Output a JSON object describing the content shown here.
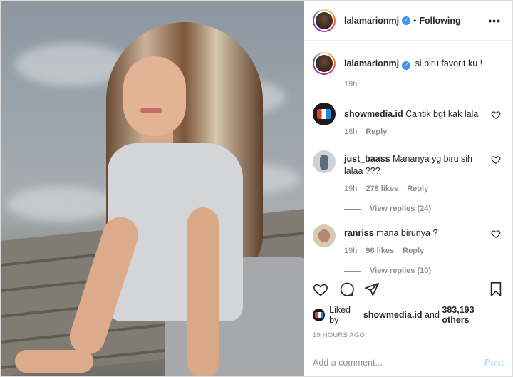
{
  "post": {
    "author": "lalamarionmj",
    "follow_separator": "•",
    "follow_state": "Following",
    "more_icon": "more-horizontal-icon"
  },
  "caption": {
    "username": "lalamarionmj",
    "text": "si biru favorit ku !",
    "time": "19h"
  },
  "comments": [
    {
      "username": "showmedia.id",
      "text": "Cantik bgt kak lala",
      "time": "18h",
      "reply_label": "Reply"
    },
    {
      "username": "just_baass",
      "text": "Mananya yg biru sih lalaa ???",
      "time": "19h",
      "likes": "278 likes",
      "reply_label": "Reply",
      "view_replies": "View replies (24)"
    },
    {
      "username": "ranriss",
      "text": "mana birunya ?",
      "time": "19h",
      "likes": "96 likes",
      "reply_label": "Reply",
      "view_replies": "View replies (10)"
    }
  ],
  "likes": {
    "prefix": "Liked by",
    "user": "showmedia.id",
    "joiner": "and",
    "others": "383,193 others"
  },
  "timestamp": "19 HOURS AGO",
  "add_comment": {
    "placeholder": "Add a comment...",
    "post_label": "Post"
  },
  "colors": {
    "verified": "#3897f0",
    "post_button_disabled": "#b2dffc",
    "muted_text": "#8e8e8e"
  }
}
